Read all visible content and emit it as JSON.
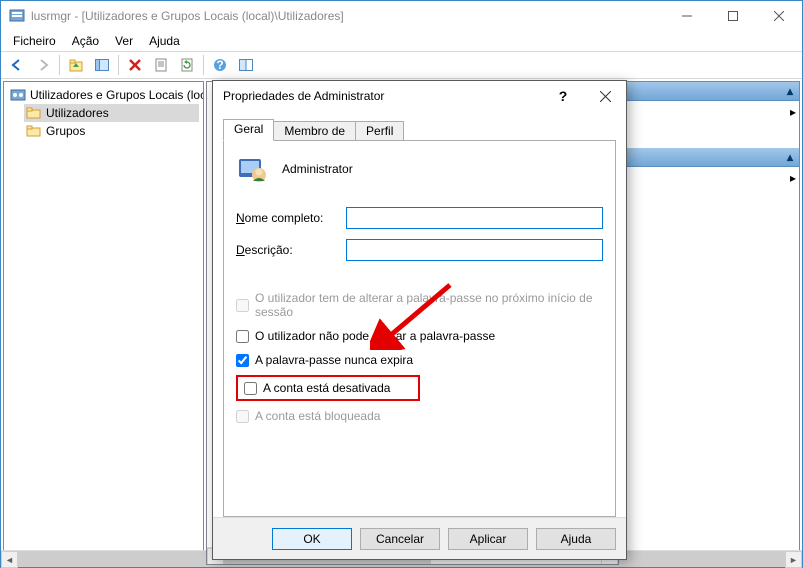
{
  "window": {
    "title": "lusrmgr - [Utilizadores e Grupos Locais (local)\\Utilizadores]"
  },
  "menu": {
    "file": "Ficheiro",
    "action": "Ação",
    "view": "Ver",
    "help": "Ajuda"
  },
  "tree": {
    "root": "Utilizadores e Grupos Locais (local)",
    "users": "Utilizadores",
    "groups": "Grupos"
  },
  "dialog": {
    "title": "Propriedades de Administrator",
    "tabs": {
      "general": "Geral",
      "memberof": "Membro de",
      "profile": "Perfil"
    },
    "username": "Administrator",
    "labels": {
      "fullname_pre": "",
      "fullname_u": "N",
      "fullname_post": "ome completo:",
      "desc_pre": "",
      "desc_u": "D",
      "desc_post": "escrição:"
    },
    "fields": {
      "fullname": "",
      "description": ""
    },
    "checks": {
      "mustchange": "O utilizador tem de alterar a palavra-passe no próximo início de sessão",
      "cannotchange": "O utilizador não pode alterar a palavra-passe",
      "neverexpires": "A palavra-passe nunca expira",
      "disabled": "A conta está desativada",
      "locked": "A conta está bloqueada"
    },
    "buttons": {
      "ok": "OK",
      "cancel": "Cancelar",
      "apply": "Aplicar",
      "help": "Ajuda"
    }
  }
}
